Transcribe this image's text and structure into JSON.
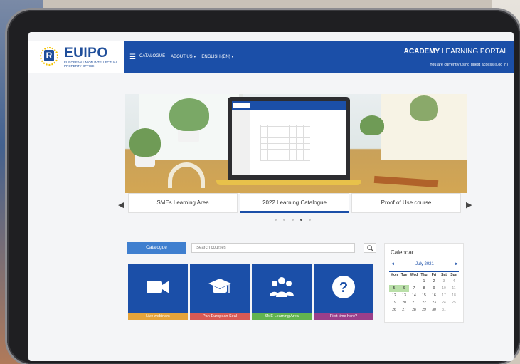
{
  "header": {
    "logo_text": "EUIPO",
    "logo_subtext": "EUROPEAN UNION INTELLECTUAL PROPERTY OFFICE",
    "nav": [
      "CATALOGUE",
      "ABOUT US ▾",
      "ENGLISH (EN) ▾"
    ],
    "portal_title_bold": "ACADEMY",
    "portal_title_rest": "LEARNING PORTAL",
    "guest_notice": "You are currently using guest access (Log in)"
  },
  "carousel": {
    "slides": [
      "SMEs Learning Area",
      "2022 Learning Catalogue",
      "Proof of Use course"
    ],
    "active_index": 1,
    "dots_count": 5,
    "active_dot": 3
  },
  "catalogue": {
    "button_label": "Catalogue",
    "search_placeholder": "Search courses"
  },
  "tiles": [
    {
      "label": "Live webinars",
      "icon": "video-camera-icon",
      "accent": "#e5a43b"
    },
    {
      "label": "Pan-European Seal",
      "icon": "graduation-cap-icon",
      "accent": "#d85a55"
    },
    {
      "label": "SME Learning Area",
      "icon": "users-icon",
      "accent": "#62b44f"
    },
    {
      "label": "First time here?",
      "icon": "question-icon",
      "accent": "#9a3f8a"
    }
  ],
  "calendar": {
    "title": "Calendar",
    "month": "July 2021",
    "prev": "◄",
    "next": "►",
    "days": [
      "Mon",
      "Tue",
      "Wed",
      "Thu",
      "Fri",
      "Sat",
      "Sun"
    ],
    "weeks": [
      [
        "",
        "",
        "",
        "1",
        "2",
        "3",
        "4"
      ],
      [
        "5",
        "6",
        "7",
        "8",
        "9",
        "10",
        "11"
      ],
      [
        "12",
        "13",
        "14",
        "15",
        "16",
        "17",
        "18"
      ],
      [
        "19",
        "20",
        "21",
        "22",
        "23",
        "24",
        "25"
      ],
      [
        "26",
        "27",
        "28",
        "29",
        "30",
        "31",
        ""
      ]
    ],
    "event_days": [
      "5",
      "6"
    ]
  },
  "colors": {
    "brand": "#1b4fa8",
    "button": "#3f7fcf"
  }
}
